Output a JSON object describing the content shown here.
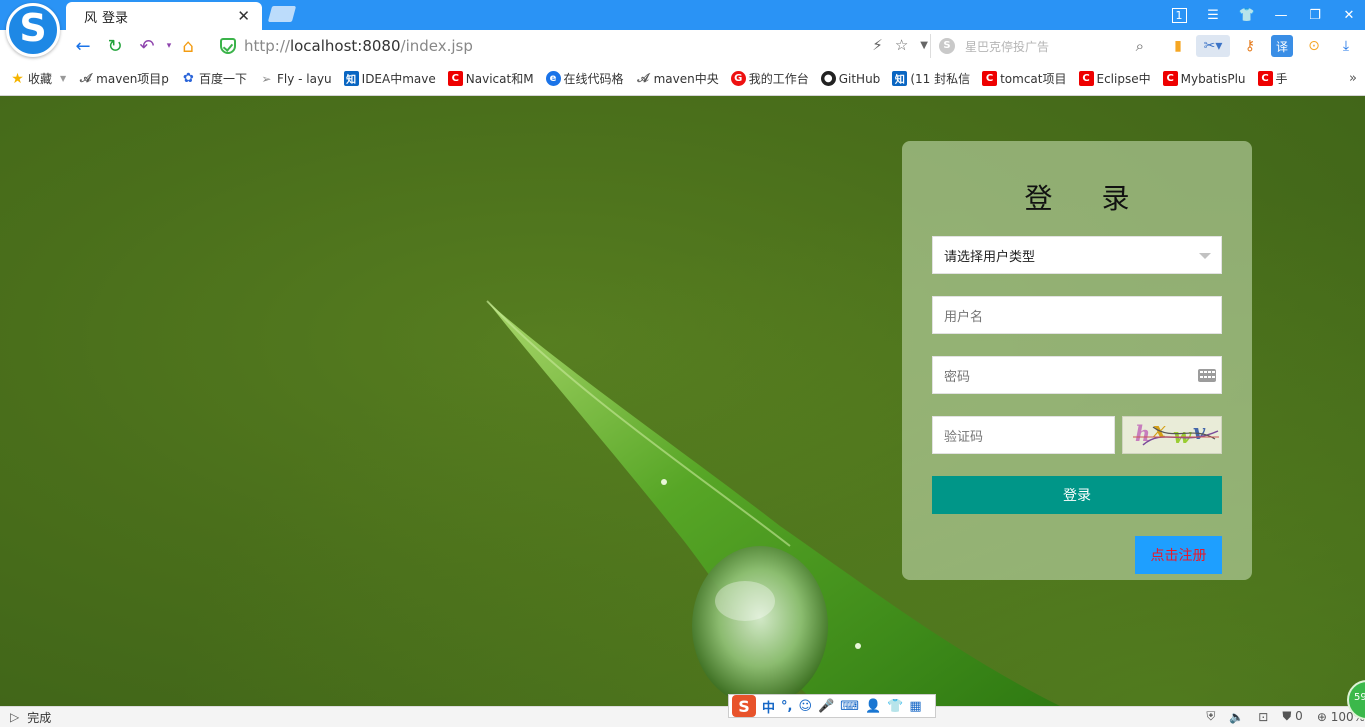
{
  "browser": {
    "tab": {
      "favicon": "风",
      "title": "登录"
    },
    "address": {
      "scheme": "http://",
      "host": "localhost:8080",
      "path": "/index.jsp"
    },
    "search_placeholder": "星巴克停投广告",
    "window_controls": {
      "tab_count": "1"
    },
    "icons": [
      "back-icon",
      "refresh-icon",
      "undo-icon",
      "home-icon",
      "lightning-icon",
      "star-icon",
      "chevron-down-icon",
      "search-icon",
      "scissors-icon",
      "translate-icon"
    ]
  },
  "bookmarks": [
    {
      "label": "收藏",
      "icon": "star"
    },
    {
      "label": "maven项目p",
      "icon": "feather"
    },
    {
      "label": "百度一下",
      "icon": "paw"
    },
    {
      "label": "Fly - layu",
      "icon": "plane"
    },
    {
      "label": "IDEA中mave",
      "icon": "zhi"
    },
    {
      "label": "Navicat和M",
      "icon": "c"
    },
    {
      "label": "在线代码格",
      "icon": "e"
    },
    {
      "label": "maven中央",
      "icon": "feather"
    },
    {
      "label": "我的工作台",
      "icon": "g"
    },
    {
      "label": "GitHub",
      "icon": "gh"
    },
    {
      "label": "(11 封私信",
      "icon": "zhi"
    },
    {
      "label": "tomcat项目",
      "icon": "c"
    },
    {
      "label": "Eclipse中",
      "icon": "c"
    },
    {
      "label": "MybatisPlu",
      "icon": "c"
    },
    {
      "label": "手",
      "icon": "c"
    }
  ],
  "login": {
    "title": "登 录",
    "user_type_placeholder": "请选择用户类型",
    "username_placeholder": "用户名",
    "password_placeholder": "密码",
    "captcha_placeholder": "验证码",
    "captcha_chars": [
      "h",
      "x",
      "w",
      "v"
    ],
    "login_button": "登录",
    "register_button": "点击注册",
    "colors": {
      "login_button": "#009688",
      "register_button": "#1e9fff",
      "register_text": "#e8192c"
    }
  },
  "statusbar": {
    "status": "完成",
    "ime_mode": "中",
    "ime_punct": "°,",
    "security_count": "0",
    "zoom": "100%",
    "corner_badge": "59"
  }
}
